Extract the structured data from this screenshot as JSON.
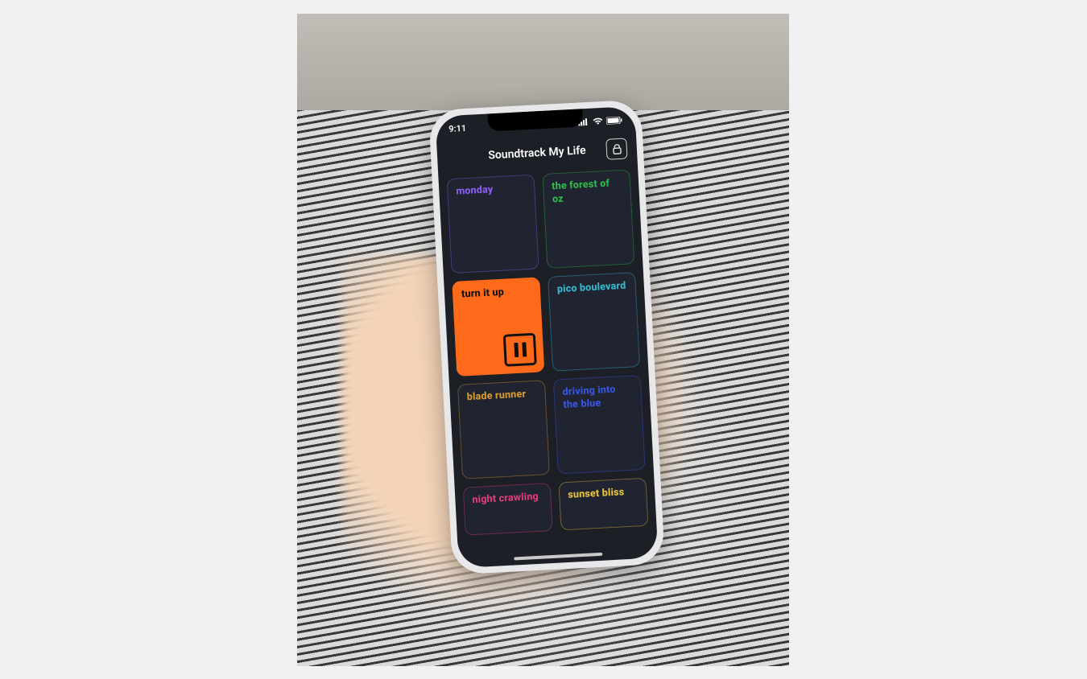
{
  "status": {
    "time": "9:11"
  },
  "header": {
    "title": "Soundtrack My Life"
  },
  "colors": {
    "purple": "#8a5cf0",
    "green": "#2fb84c",
    "orange": "#ff6a1a",
    "cyan": "#33b8cc",
    "amber": "#d79a2b",
    "blue": "#3a55e0",
    "pink": "#e23a7a",
    "yellow": "#e8c23a"
  },
  "tiles": [
    {
      "label": "monday",
      "color": "purple",
      "border": "purple",
      "active": false
    },
    {
      "label": "the forest of oz",
      "color": "green",
      "border": "green",
      "active": false
    },
    {
      "label": "turn it up",
      "color": "orange",
      "border": "orange",
      "active": true
    },
    {
      "label": "pico boulevard",
      "color": "cyan",
      "border": "cyan",
      "active": false
    },
    {
      "label": "blade runner",
      "color": "amber",
      "border": "amber",
      "active": false
    },
    {
      "label": "driving into the blue",
      "color": "blue",
      "border": "blue",
      "active": false
    },
    {
      "label": "night crawling",
      "color": "pink",
      "border": "pink",
      "active": false,
      "partial": true
    },
    {
      "label": "sunset bliss",
      "color": "yellow",
      "border": "yellow",
      "active": false,
      "partial": true
    }
  ]
}
